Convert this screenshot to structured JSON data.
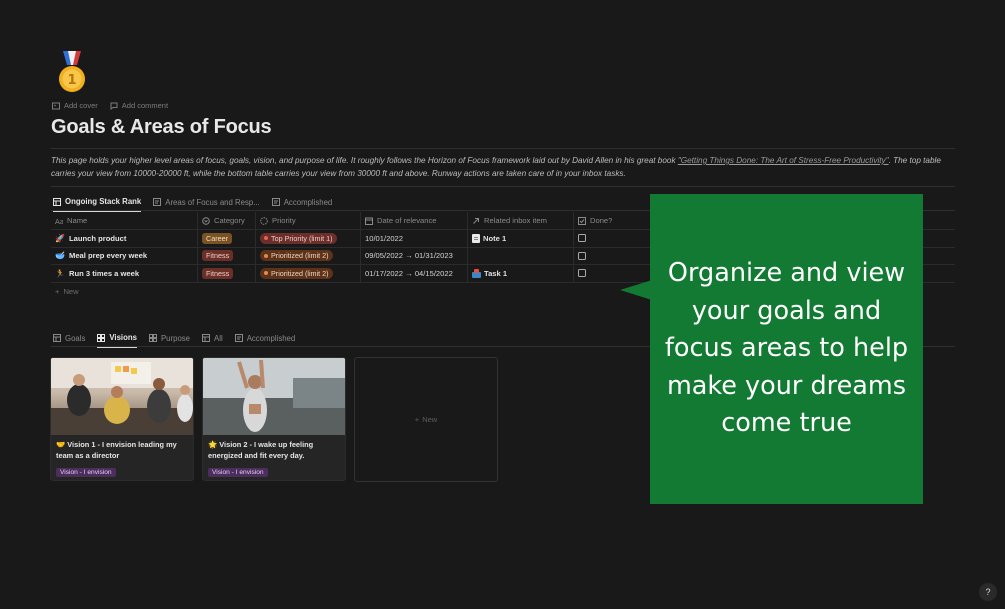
{
  "page": {
    "icon": "medal-icon",
    "actions": [
      {
        "label": "Add cover",
        "icon": "image-icon"
      },
      {
        "label": "Add comment",
        "icon": "comment-icon"
      }
    ],
    "title": "Goals & Areas of Focus",
    "description_prefix": "This page holds your higher level areas of focus, goals, vision, and purpose of life. It roughly follows the Horizon of Focus framework laid out by David Allen in his great book ",
    "description_link": "\"Getting Things Done: The Art of Stress-Free Productivity\"",
    "description_suffix": ". The top table carries your view from 10000-20000 ft, while the bottom table carries your view from 30000 ft and above. Runway actions are taken care of in your inbox tasks."
  },
  "top_view": {
    "tabs": [
      {
        "label": "Ongoing Stack Rank",
        "icon": "table-icon",
        "active": true
      },
      {
        "label": "Areas of Focus and Resp...",
        "icon": "board-icon",
        "active": false
      },
      {
        "label": "Accomplished",
        "icon": "board-icon",
        "active": false
      }
    ],
    "columns": [
      "Name",
      "Category",
      "Priority",
      "Date of relevance",
      "Related inbox item",
      "Done?"
    ],
    "rows": [
      {
        "emoji": "🚀",
        "name": "Launch product",
        "category": "Career",
        "priority": "Top Priority (limit 1)",
        "date": "10/01/2022",
        "inbox": "Note 1"
      },
      {
        "emoji": "🥣",
        "name": "Meal prep every week",
        "category": "Fitness",
        "priority": "Prioritized (limit 2)",
        "date": "09/05/2022 → 01/31/2023",
        "inbox": ""
      },
      {
        "emoji": "🏃",
        "name": "Run 3 times a week",
        "category": "Fitness",
        "priority": "Prioritized (limit 2)",
        "date": "01/17/2022 → 04/15/2022",
        "inbox": "Task 1"
      }
    ],
    "new_label": "New"
  },
  "bottom_view": {
    "tabs": [
      {
        "label": "Goals",
        "icon": "table-icon",
        "active": false
      },
      {
        "label": "Visions",
        "icon": "table-icon",
        "active": true
      },
      {
        "label": "Purpose",
        "icon": "table-icon",
        "active": false
      },
      {
        "label": "All",
        "icon": "table-icon",
        "active": false
      },
      {
        "label": "Accomplished",
        "icon": "board-icon",
        "active": false
      }
    ],
    "cards": [
      {
        "emoji": "🤝",
        "text": "Vision 1 - I envision leading my team as a director",
        "tag": "Vision - I envision"
      },
      {
        "emoji": "🌟",
        "text": "Vision 2 - I wake up feeling energized and fit every day.",
        "tag": "Vision - I envision"
      }
    ],
    "new_label": "New"
  },
  "callout": {
    "text": "Organize and view your goals and focus areas to help make your dreams come true",
    "color": "#127a32"
  },
  "help_label": "?"
}
